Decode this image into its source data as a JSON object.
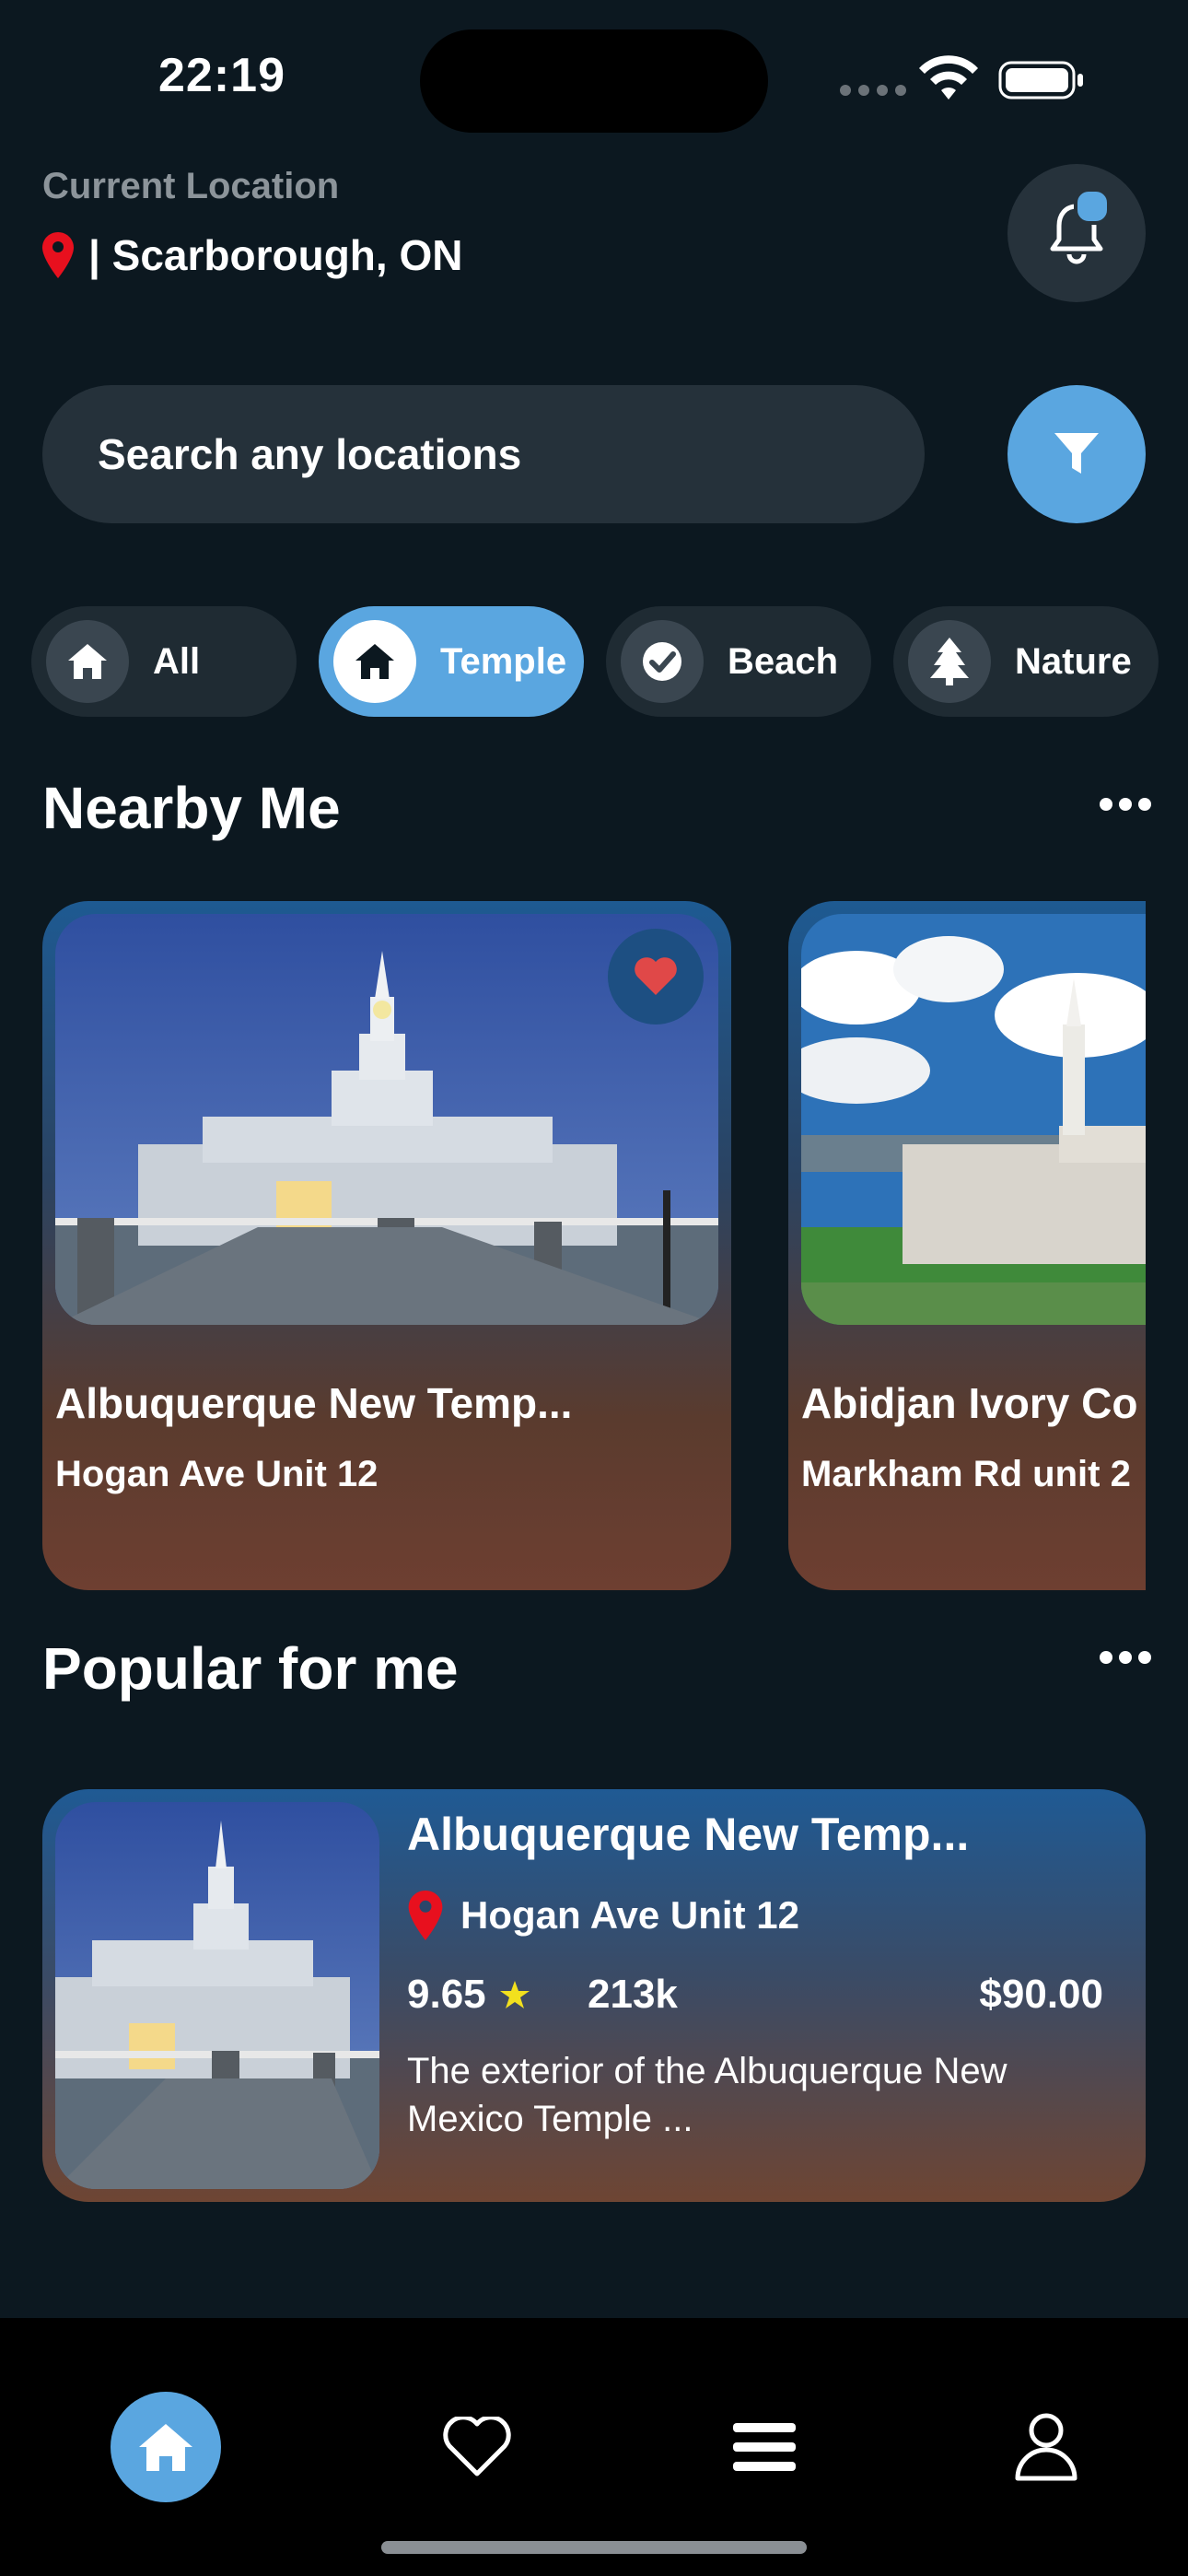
{
  "status_bar": {
    "time": "22:19"
  },
  "header": {
    "location_label": "Current Location",
    "location_value": "| Scarborough, ON"
  },
  "search": {
    "placeholder": "Search any locations"
  },
  "categories": [
    {
      "label": "All",
      "icon": "home-icon",
      "active": false
    },
    {
      "label": "Temple",
      "icon": "home-icon",
      "active": true
    },
    {
      "label": "Beach",
      "icon": "check-circle-icon",
      "active": false
    },
    {
      "label": "Nature",
      "icon": "tree-icon",
      "active": false
    }
  ],
  "nearby": {
    "title": "Nearby Me",
    "cards": [
      {
        "title": "Albuquerque New Temp...",
        "address": "Hogan Ave Unit 12",
        "favorited": true
      },
      {
        "title": "Abidjan Ivory Co",
        "address": "Markham Rd unit 2",
        "favorited": false
      }
    ]
  },
  "popular": {
    "title": "Popular for me",
    "item": {
      "title": "Albuquerque New Temp...",
      "address": "Hogan Ave Unit 12",
      "rating": "9.65",
      "views": "213k",
      "price": "$90.00",
      "description": "The exterior of the Albuquerque New Mexico Temple ..."
    }
  },
  "tabs": [
    {
      "name": "home",
      "icon": "home-icon",
      "active": true
    },
    {
      "name": "favorites",
      "icon": "heart-icon",
      "active": false
    },
    {
      "name": "menu",
      "icon": "menu-icon",
      "active": false
    },
    {
      "name": "profile",
      "icon": "user-icon",
      "active": false
    }
  ],
  "colors": {
    "background": "#0c1820",
    "accent": "#5aa6e0",
    "pin": "#e8101e",
    "heart": "#e04848",
    "star": "#f2e01e"
  }
}
